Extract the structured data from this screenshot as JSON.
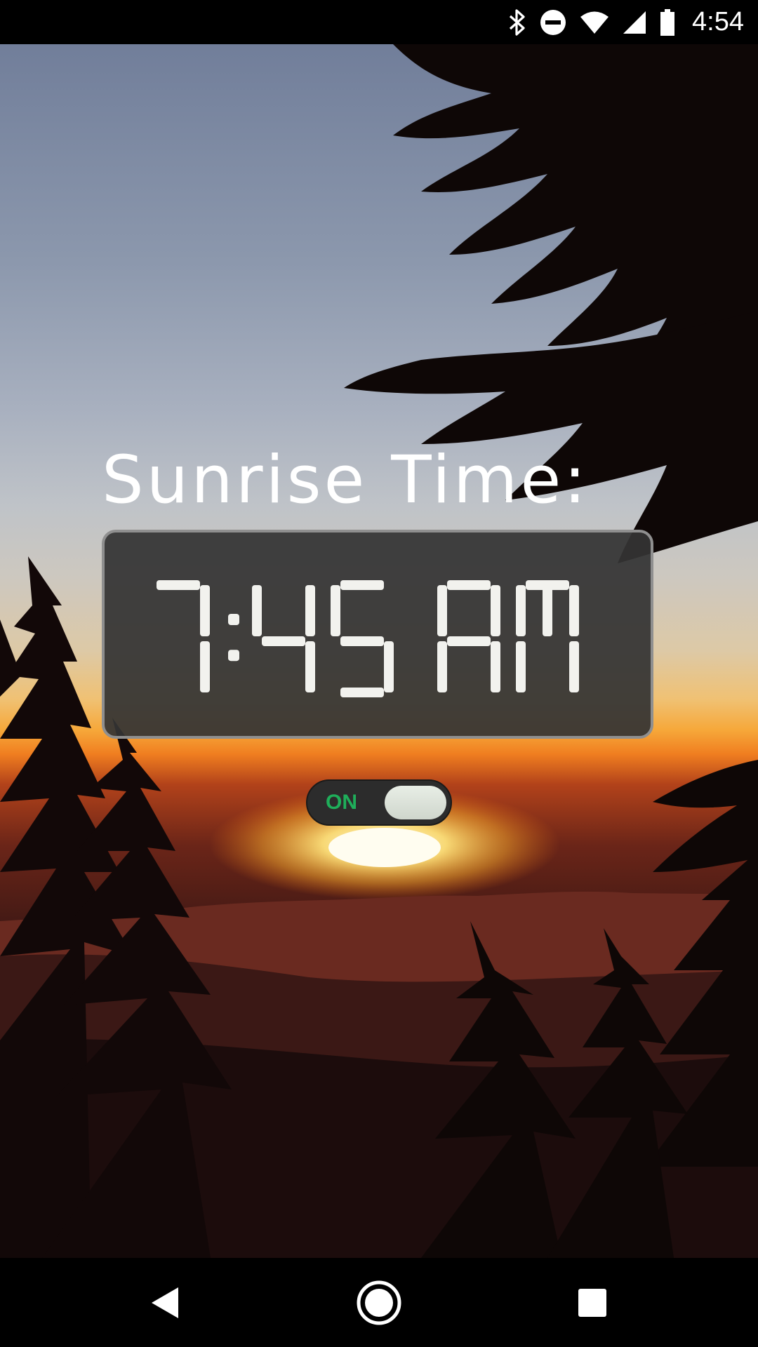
{
  "status_bar": {
    "time": "4:54",
    "icons": [
      "bluetooth-icon",
      "do-not-disturb-icon",
      "wifi-icon",
      "cell-signal-icon",
      "battery-icon"
    ]
  },
  "alarm": {
    "label": "Sunrise Time:",
    "time": "7:45 AM",
    "toggle_label": "ON",
    "toggle_on": true
  },
  "colors": {
    "toggle_accent": "#1fae5a",
    "clock_digit": "#f2f2ee"
  },
  "nav_bar": {
    "icons": [
      "back-icon",
      "home-icon",
      "recents-icon"
    ]
  }
}
